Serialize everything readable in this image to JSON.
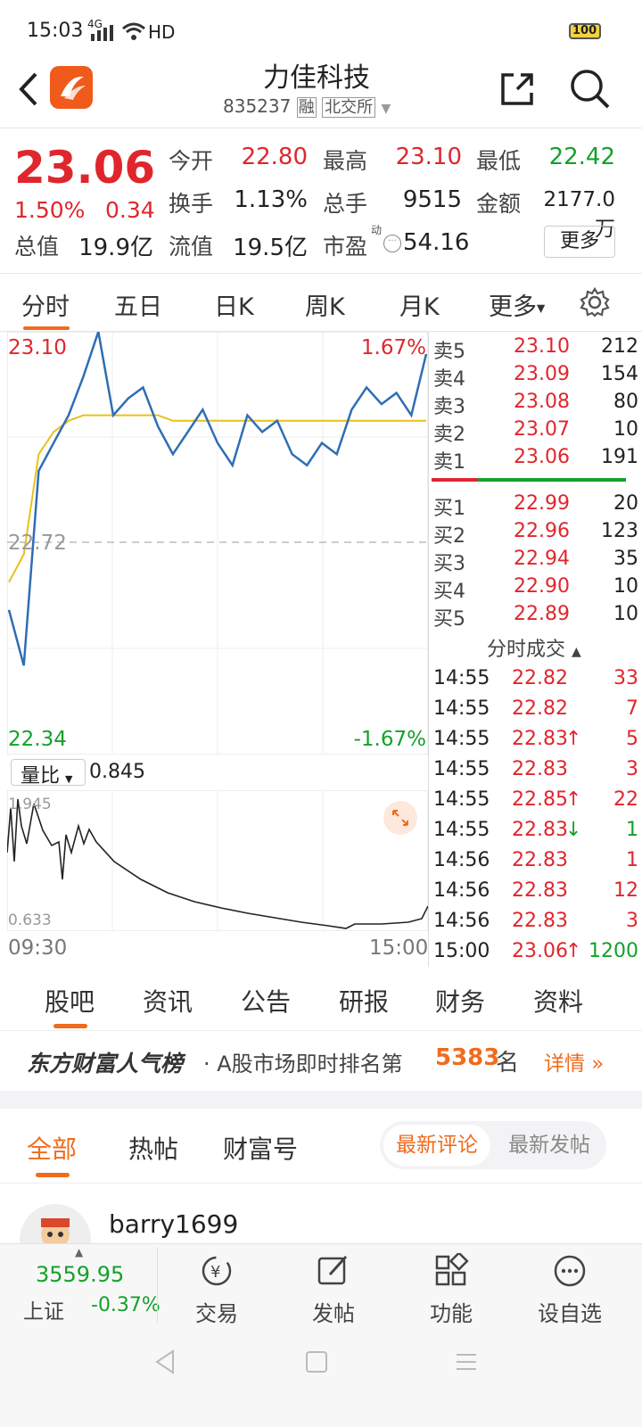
{
  "status": {
    "time": "15:03",
    "signal": "4G",
    "net": "HD",
    "battery": "100"
  },
  "header": {
    "title": "力佳科技",
    "code": "835237",
    "tag1": "融",
    "tag2": "北交所"
  },
  "quote": {
    "price": "23.06",
    "pct": "1.50%",
    "change": "0.34",
    "open_label": "今开",
    "open": "22.80",
    "high_label": "最高",
    "high": "23.10",
    "low_label": "最低",
    "low": "22.42",
    "turnover_label": "换手",
    "turnover": "1.13%",
    "volume_label": "总手",
    "volume": "9515",
    "amount_label": "金额",
    "amount": "2177.0万",
    "mktcap_label": "总值",
    "mktcap": "19.9亿",
    "float_label": "流值",
    "float": "19.5亿",
    "pe_label": "市盈",
    "pe_sup": "动",
    "pe": "54.16",
    "more_label": "更多"
  },
  "chart_tabs": [
    "分时",
    "五日",
    "日K",
    "周K",
    "月K",
    "更多"
  ],
  "chart": {
    "top_price": "23.10",
    "top_pct": "1.67%",
    "mid_price": "22.72",
    "bottom_price": "22.34",
    "bottom_pct": "-1.67%",
    "vol_label": "量比",
    "vol_value": "0.845",
    "vol_top": "1.945",
    "vol_bottom": "0.633",
    "time_start": "09:30",
    "time_end": "15:00"
  },
  "chart_data": {
    "type": "line",
    "series": [
      {
        "values": [
          22.6,
          22.5,
          22.85,
          22.9,
          22.95,
          23.02,
          23.1,
          22.95,
          22.98,
          23.0,
          22.93,
          22.88,
          22.92,
          22.96,
          22.9,
          22.86,
          22.95,
          22.92,
          22.94,
          22.88,
          22.86,
          22.9,
          22.88,
          22.96,
          23.0,
          22.97,
          22.99,
          22.95,
          23.06
        ]
      },
      {
        "values": [
          22.65,
          22.7,
          22.88,
          22.92,
          22.94,
          22.95,
          22.95,
          22.95,
          22.95,
          22.95,
          22.95,
          22.94,
          22.94,
          22.94,
          22.94,
          22.94,
          22.94,
          22.94,
          22.94,
          22.94,
          22.94,
          22.94,
          22.94,
          22.94,
          22.94,
          22.94,
          22.94,
          22.94,
          22.94
        ]
      }
    ],
    "ylim": [
      22.34,
      23.1
    ]
  },
  "order_book": {
    "asks": [
      {
        "label": "卖5",
        "price": "23.10",
        "vol": "212"
      },
      {
        "label": "卖4",
        "price": "23.09",
        "vol": "154"
      },
      {
        "label": "卖3",
        "price": "23.08",
        "vol": "80"
      },
      {
        "label": "卖2",
        "price": "23.07",
        "vol": "10"
      },
      {
        "label": "卖1",
        "price": "23.06",
        "vol": "191"
      }
    ],
    "bids": [
      {
        "label": "买1",
        "price": "22.99",
        "vol": "20"
      },
      {
        "label": "买2",
        "price": "22.96",
        "vol": "123"
      },
      {
        "label": "买3",
        "price": "22.94",
        "vol": "35"
      },
      {
        "label": "买4",
        "price": "22.90",
        "vol": "10"
      },
      {
        "label": "买5",
        "price": "22.89",
        "vol": "10"
      }
    ],
    "trades_title": "分时成交",
    "trades": [
      {
        "time": "14:55",
        "price": "22.82",
        "arrow": "",
        "vol": "33"
      },
      {
        "time": "14:55",
        "price": "22.82",
        "arrow": "",
        "vol": "7"
      },
      {
        "time": "14:55",
        "price": "22.83",
        "arrow": "↑",
        "vol": "5"
      },
      {
        "time": "14:55",
        "price": "22.83",
        "arrow": "",
        "vol": "3"
      },
      {
        "time": "14:55",
        "price": "22.85",
        "arrow": "↑",
        "vol": "22"
      },
      {
        "time": "14:55",
        "price": "22.83",
        "arrow": "↓",
        "vol": "1"
      },
      {
        "time": "14:56",
        "price": "22.83",
        "arrow": "",
        "vol": "1"
      },
      {
        "time": "14:56",
        "price": "22.83",
        "arrow": "",
        "vol": "12"
      },
      {
        "time": "14:56",
        "price": "22.83",
        "arrow": "",
        "vol": "3"
      },
      {
        "time": "15:00",
        "price": "23.06",
        "arrow": "↑",
        "vol": "1200"
      }
    ]
  },
  "bottom_tabs": [
    "股吧",
    "资讯",
    "公告",
    "研报",
    "财务",
    "资料"
  ],
  "rank": {
    "brand": "东方财富人气榜",
    "text": "· A股市场即时排名第",
    "num": "5383",
    "suffix": "名",
    "detail": "详情"
  },
  "forum_tabs": [
    "全部",
    "热帖",
    "财富号"
  ],
  "sort": {
    "latest_comment": "最新评论",
    "latest_post": "最新发帖"
  },
  "post": {
    "user": "barry1699"
  },
  "bottom_nav": {
    "index_value": "3559.95",
    "index_name": "上证",
    "index_pct": "-0.37%",
    "trade": "交易",
    "post": "发帖",
    "func": "功能",
    "watch": "设自选"
  },
  "colors": {
    "up": "#e0262d",
    "down": "#14a12a",
    "accent": "#f06b1d",
    "line": "#2f6db5",
    "avg": "#e8c11a"
  }
}
